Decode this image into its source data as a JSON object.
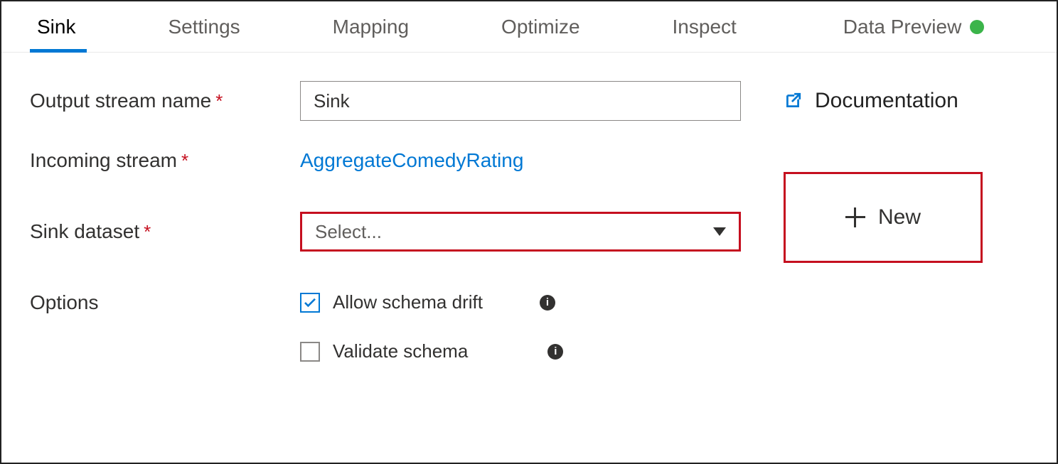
{
  "tabs": {
    "sink": "Sink",
    "settings": "Settings",
    "mapping": "Mapping",
    "optimize": "Optimize",
    "inspect": "Inspect",
    "dataPreview": "Data Preview"
  },
  "labels": {
    "outputStreamName": "Output stream name",
    "incomingStream": "Incoming stream",
    "sinkDataset": "Sink dataset",
    "options": "Options"
  },
  "fields": {
    "outputStreamValue": "Sink",
    "incomingStreamLink": "AggregateComedyRating",
    "sinkDatasetPlaceholder": "Select..."
  },
  "options": {
    "allowSchemaDrift": "Allow schema drift",
    "validateSchema": "Validate schema"
  },
  "buttons": {
    "new": "New",
    "documentation": "Documentation"
  }
}
